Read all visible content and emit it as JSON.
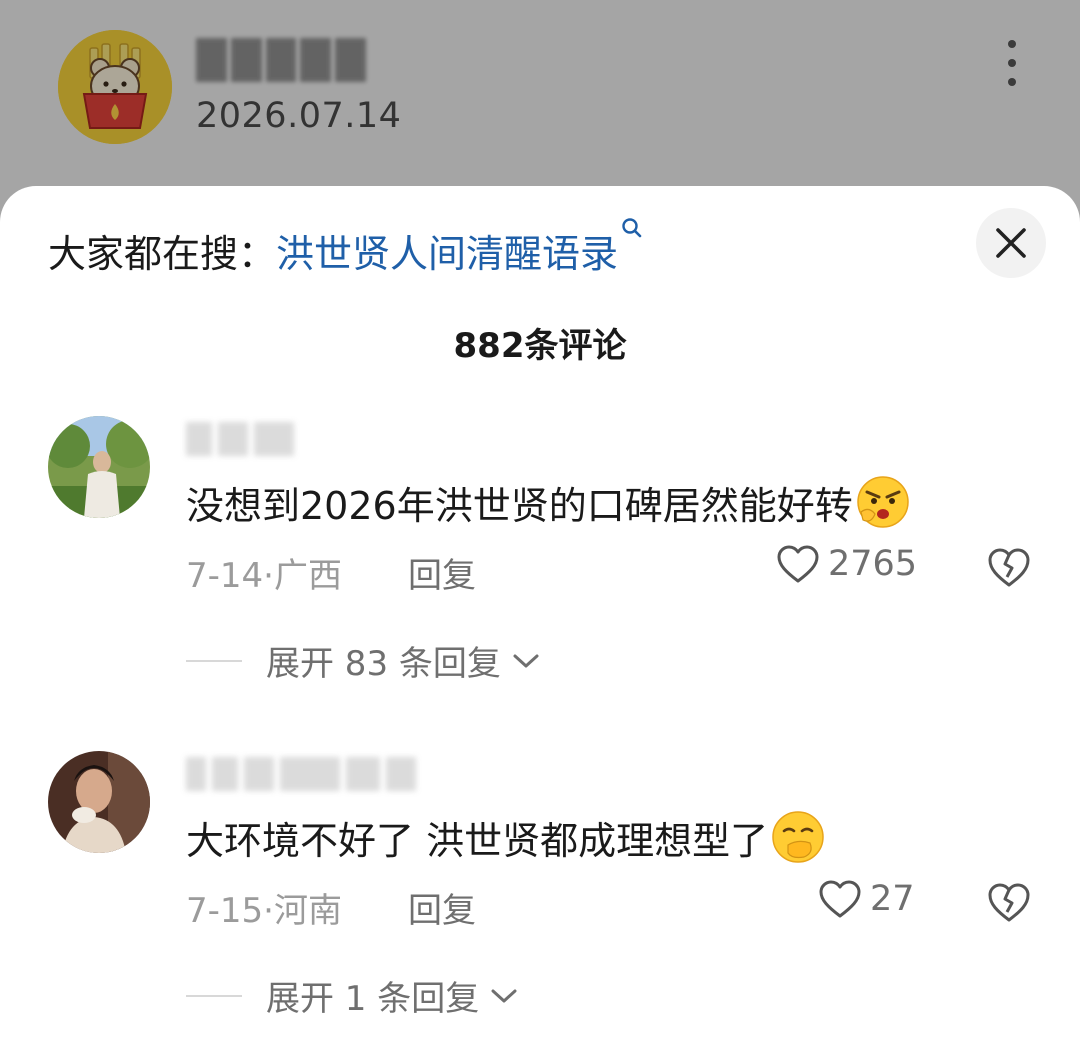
{
  "post_header": {
    "date": "2026.07.14"
  },
  "search": {
    "prefix": "大家都在搜：",
    "keyword": "洪世贤人间清醒语录"
  },
  "comments_title": "882条评论",
  "comments": [
    {
      "text": "没想到2026年洪世贤的口碑居然能好转",
      "emoji": "angry-face-emoji",
      "meta": "7-14·广西",
      "reply_label": "回复",
      "likes": "2765",
      "expand_label": "展开 83 条回复"
    },
    {
      "text": "大环境不好了 洪世贤都成理想型了",
      "emoji": "hand-over-mouth-emoji",
      "meta": "7-15·河南",
      "reply_label": "回复",
      "likes": "27",
      "expand_label": "展开 1 条回复"
    }
  ],
  "colors": {
    "keyword": "#1f5fa8",
    "muted": "#9b9b9b",
    "text": "#1a1a1a"
  }
}
